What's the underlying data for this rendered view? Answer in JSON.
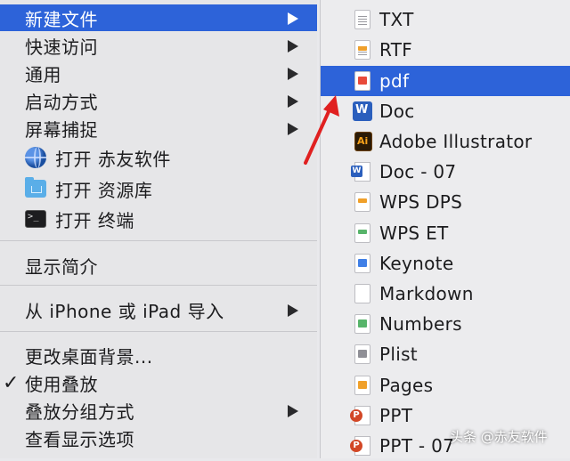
{
  "main_menu": {
    "items": [
      {
        "label": "新建文件",
        "submenu": true,
        "active": true
      },
      {
        "label": "快速访问",
        "submenu": true
      },
      {
        "label": "通用",
        "submenu": true
      },
      {
        "label": "启动方式",
        "submenu": true
      },
      {
        "label": "屏幕捕捉",
        "submenu": true
      },
      {
        "label": "打开 赤友软件",
        "icon": "globe-icon"
      },
      {
        "label": "打开 资源库",
        "icon": "folder-icon"
      },
      {
        "label": "打开 终端",
        "icon": "terminal-icon"
      },
      {
        "label": "显示简介"
      },
      {
        "label": "从 iPhone 或 iPad 导入",
        "submenu": true
      },
      {
        "label": "更改桌面背景..."
      },
      {
        "label": "使用叠放",
        "checked": true,
        "check_mark": "✓"
      },
      {
        "label": "叠放分组方式",
        "submenu": true
      },
      {
        "label": "查看显示选项"
      }
    ]
  },
  "submenu": {
    "items": [
      {
        "label": "TXT",
        "icon": "txt-file-icon"
      },
      {
        "label": "RTF",
        "icon": "rtf-file-icon"
      },
      {
        "label": "pdf",
        "icon": "pdf-file-icon",
        "active": true
      },
      {
        "label": "Doc",
        "icon": "word-icon"
      },
      {
        "label": "Adobe Illustrator",
        "icon": "illustrator-icon"
      },
      {
        "label": "Doc - 07",
        "icon": "word-doc-icon"
      },
      {
        "label": "WPS DPS",
        "icon": "wps-dps-file-icon"
      },
      {
        "label": "WPS ET",
        "icon": "wps-et-file-icon"
      },
      {
        "label": "Keynote",
        "icon": "keynote-file-icon"
      },
      {
        "label": "Markdown",
        "icon": "markdown-file-icon"
      },
      {
        "label": "Numbers",
        "icon": "numbers-file-icon"
      },
      {
        "label": "Plist",
        "icon": "plist-file-icon"
      },
      {
        "label": "Pages",
        "icon": "pages-file-icon"
      },
      {
        "label": "PPT",
        "icon": "ppt-file-icon"
      },
      {
        "label": "PPT - 07",
        "icon": "ppt-file-icon"
      }
    ]
  },
  "watermark": "头条 @赤友软件",
  "colors": {
    "selection": "#2d63d9",
    "annotation_arrow": "#e02020"
  }
}
